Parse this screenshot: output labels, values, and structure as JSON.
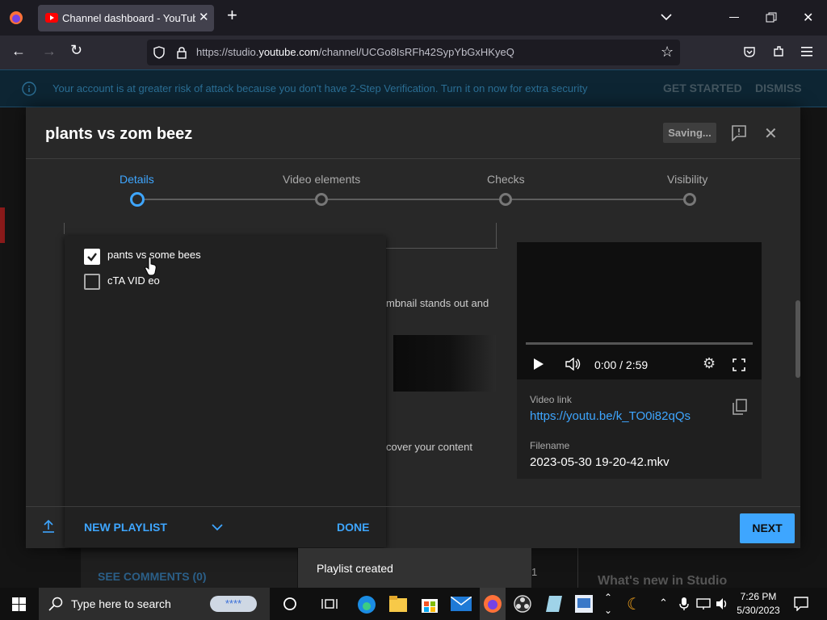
{
  "browser": {
    "tab_title": "Channel dashboard - YouTube Studio",
    "url_prefix": "https://studio.",
    "url_domain": "youtube.com",
    "url_path": "/channel/UCGo8IsRFh42SypYbGxHKyeQ"
  },
  "banner": {
    "text": "Your account is at greater risk of attack because you don't have 2-Step Verification. Turn it on now for extra security",
    "get_started": "GET STARTED",
    "dismiss": "DISMISS"
  },
  "dialog": {
    "title": "plants vs zom beez",
    "saving": "Saving...",
    "steps": [
      "Details",
      "Video elements",
      "Checks",
      "Visibility"
    ],
    "bg_text_1": "mbnail stands out and",
    "bg_text_2": "cover your content"
  },
  "playlists": {
    "items": [
      {
        "label": "pants vs some bees",
        "checked": true
      },
      {
        "label": "cTA VID eo",
        "checked": false
      }
    ],
    "new_playlist": "NEW PLAYLIST",
    "done": "DONE"
  },
  "preview": {
    "time": "0:00 / 2:59",
    "video_link_label": "Video link",
    "video_link": "https://youtu.be/k_TO0i82qQs",
    "filename_label": "Filename",
    "filename": "2023-05-30 19-20-42.mkv",
    "progress": 0
  },
  "next_label": "NEXT",
  "background": {
    "see_comments": "SEE COMMENTS (0)",
    "whats_new": "What's new in Studio",
    "count": "1"
  },
  "snackbar": "Playlist created",
  "taskbar": {
    "search_placeholder": "Type here to search",
    "time": "7:26 PM",
    "date": "5/30/2023"
  }
}
